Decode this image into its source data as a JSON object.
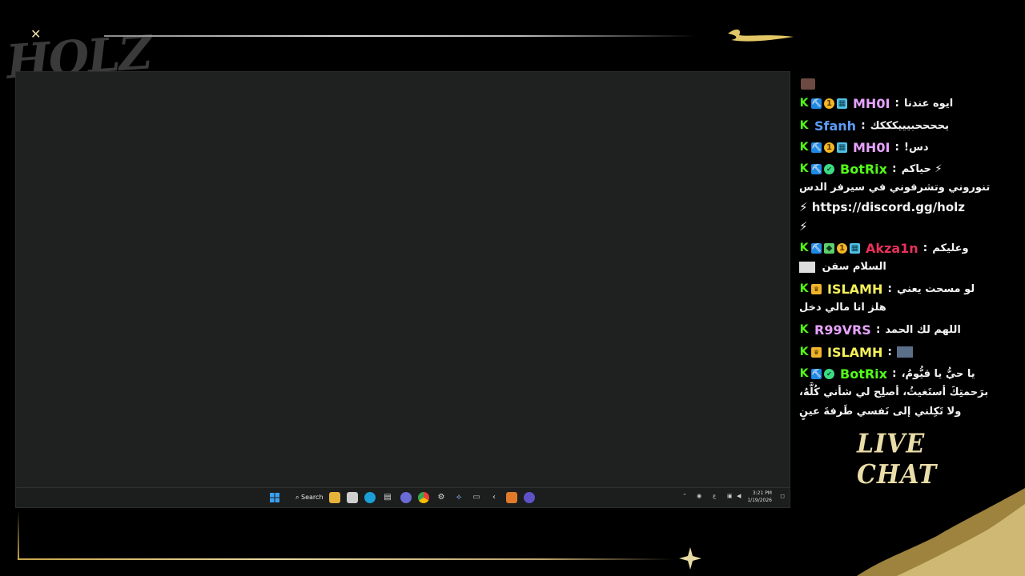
{
  "overlay": {
    "logo_text": "HOLZ",
    "live_chat_label": "LIVE CHAT"
  },
  "taskbar": {
    "search_label": "Search",
    "clock_time": "3:21 PM",
    "clock_date": "1/19/2026",
    "tray_lang": "ع"
  },
  "chat": {
    "messages": [
      {
        "user": "MH0I",
        "user_color": "#e7a3ff",
        "badges": [
          "kick-icon",
          "pickaxe-icon",
          "gold-coin-icon",
          "sub-gift-icon"
        ],
        "text": "ايوه عندنا"
      },
      {
        "user": "Sfanh",
        "user_color": "#5b9cf5",
        "badges": [
          "kick-icon"
        ],
        "text": "يححححبيييكككك"
      },
      {
        "user": "MH0I",
        "user_color": "#e7a3ff",
        "badges": [
          "kick-icon",
          "pickaxe-icon",
          "gold-coin-icon",
          "sub-gift-icon"
        ],
        "text": "دس!"
      },
      {
        "user": "BotRix",
        "user_color": "#53fc18",
        "badges": [
          "kick-icon",
          "pickaxe-icon",
          "verified-icon"
        ],
        "text": "⚡ حياكم",
        "line2": "تنوروني وتشرفوني في سيرفر الدس",
        "line3": "⚡ https://discord.gg/holz",
        "line4": "⚡"
      },
      {
        "user": "Akza1n",
        "user_color": "#e8315a",
        "badges": [
          "kick-icon",
          "pickaxe-icon",
          "cube-icon",
          "gold-coin-icon",
          "sub-gift-icon"
        ],
        "text": "وعليكم",
        "line2": "السلام سفن"
      },
      {
        "user": "ISLAMH",
        "user_color": "#f4f05a",
        "badges": [
          "kick-icon",
          "crown-icon"
        ],
        "text": "لو مسحت يعني",
        "line2": "هلز انا مالي دخل"
      },
      {
        "user": "R99VRS",
        "user_color": "#e7a3ff",
        "badges": [
          "kick-icon"
        ],
        "text": "اللهم لك الحمد"
      },
      {
        "user": "ISLAMH",
        "user_color": "#f4f05a",
        "badges": [
          "kick-icon",
          "crown-icon"
        ],
        "text": ""
      },
      {
        "user": "BotRix",
        "user_color": "#53fc18",
        "badges": [
          "kick-icon",
          "pickaxe-icon",
          "verified-icon"
        ],
        "text": "يا حيُّ يا قيُّومُ،",
        "line2": "برَحمتِكَ أستَغيثُ، أصلِح لي شأني كُلَّهُ،",
        "line3": "ولا تَكِلني إلى نَفسي طَرفةَ عينٍ"
      }
    ],
    "colon": ":"
  },
  "colors": {
    "gold_accent": "#c9a64a",
    "screen_bg": "#1f2120",
    "kick_green": "#53fc18"
  }
}
